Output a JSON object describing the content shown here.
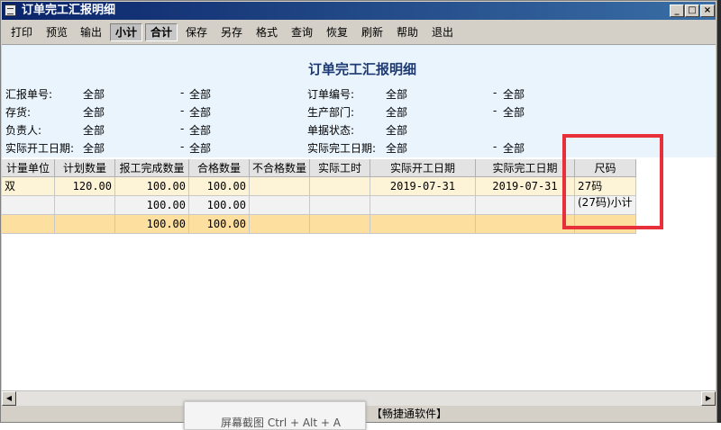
{
  "window": {
    "title": "订单完工汇报明细",
    "min_glyph": "_",
    "max_glyph": "□",
    "close_glyph": "×"
  },
  "toolbar": {
    "buttons": [
      "打印",
      "预览",
      "输出",
      "小计",
      "合计",
      "保存",
      "另存",
      "格式",
      "查询",
      "恢复",
      "刷新",
      "帮助",
      "退出"
    ]
  },
  "report": {
    "title": "订单完工汇报明细",
    "dash": "-",
    "filters": [
      {
        "label": "汇报单号:",
        "from": "全部",
        "to": "全部"
      },
      {
        "label": "订单编号:",
        "from": "全部",
        "to": "全部"
      },
      {
        "label": "存货:",
        "from": "全部",
        "to": "全部"
      },
      {
        "label": "生产部门:",
        "from": "全部",
        "to": "全部"
      },
      {
        "label": "负责人:",
        "from": "全部",
        "to": "全部"
      },
      {
        "label": "单据状态:",
        "from": "全部"
      },
      {
        "label": "实际开工日期:",
        "from": "全部",
        "to": "全部"
      },
      {
        "label": "实际完工日期:",
        "from": "全部",
        "to": "全部"
      }
    ]
  },
  "table": {
    "headers": [
      "计量单位",
      "计划数量",
      "报工完成数量",
      "合格数量",
      "不合格数量",
      "实际工时",
      "实际开工日期",
      "实际完工日期",
      "尺码"
    ],
    "rows": [
      [
        "双",
        "120.00",
        "100.00",
        "100.00",
        "",
        "",
        "2019-07-31",
        "2019-07-31",
        "27码"
      ],
      [
        "",
        "",
        "100.00",
        "100.00",
        "",
        "",
        "",
        "",
        "(27码)小计"
      ],
      [
        "",
        "",
        "100.00",
        "100.00",
        "",
        "",
        "",
        "",
        ""
      ]
    ]
  },
  "statusbar": {
    "brand": "【畅捷通软件】",
    "tooltip": "屏幕截图 Ctrl + Alt + A"
  },
  "colors": {
    "title_text": "#1e3a74",
    "header_bg": "#e9f4fd",
    "highlight": "#e8303a"
  }
}
